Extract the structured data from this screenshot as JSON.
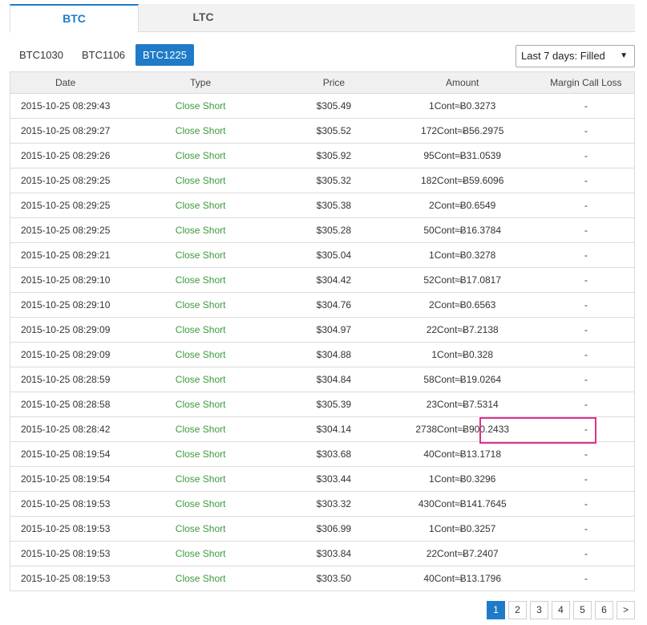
{
  "tabs": [
    {
      "label": "BTC",
      "active": true
    },
    {
      "label": "LTC",
      "active": false
    }
  ],
  "contract_tabs": [
    {
      "label": "BTC1030",
      "active": false
    },
    {
      "label": "BTC1106",
      "active": false
    },
    {
      "label": "BTC1225",
      "active": true
    }
  ],
  "filter": {
    "selected": "Last 7 days: Filled"
  },
  "colors": {
    "accent": "#1f7bc8",
    "type_text": "#3c9a3c",
    "highlight": "#e0308a"
  },
  "table": {
    "headers": [
      "Date",
      "Type",
      "Price",
      "Amount",
      "Margin Call Loss"
    ],
    "rows": [
      [
        "2015-10-25 08:29:43",
        "Close Short",
        "$305.49",
        "1Cont≈Ƀ0.3273",
        "-"
      ],
      [
        "2015-10-25 08:29:27",
        "Close Short",
        "$305.52",
        "172Cont≈Ƀ56.2975",
        "-"
      ],
      [
        "2015-10-25 08:29:26",
        "Close Short",
        "$305.92",
        "95Cont≈Ƀ31.0539",
        "-"
      ],
      [
        "2015-10-25 08:29:25",
        "Close Short",
        "$305.32",
        "182Cont≈Ƀ59.6096",
        "-"
      ],
      [
        "2015-10-25 08:29:25",
        "Close Short",
        "$305.38",
        "2Cont≈Ƀ0.6549",
        "-"
      ],
      [
        "2015-10-25 08:29:25",
        "Close Short",
        "$305.28",
        "50Cont≈Ƀ16.3784",
        "-"
      ],
      [
        "2015-10-25 08:29:21",
        "Close Short",
        "$305.04",
        "1Cont≈Ƀ0.3278",
        "-"
      ],
      [
        "2015-10-25 08:29:10",
        "Close Short",
        "$304.42",
        "52Cont≈Ƀ17.0817",
        "-"
      ],
      [
        "2015-10-25 08:29:10",
        "Close Short",
        "$304.76",
        "2Cont≈Ƀ0.6563",
        "-"
      ],
      [
        "2015-10-25 08:29:09",
        "Close Short",
        "$304.97",
        "22Cont≈Ƀ7.2138",
        "-"
      ],
      [
        "2015-10-25 08:29:09",
        "Close Short",
        "$304.88",
        "1Cont≈Ƀ0.328",
        "-"
      ],
      [
        "2015-10-25 08:28:59",
        "Close Short",
        "$304.84",
        "58Cont≈Ƀ19.0264",
        "-"
      ],
      [
        "2015-10-25 08:28:58",
        "Close Short",
        "$305.39",
        "23Cont≈Ƀ7.5314",
        "-"
      ],
      [
        "2015-10-25 08:28:42",
        "Close Short",
        "$304.14",
        "2738Cont≈Ƀ900.2433",
        "-"
      ],
      [
        "2015-10-25 08:19:54",
        "Close Short",
        "$303.68",
        "40Cont≈Ƀ13.1718",
        "-"
      ],
      [
        "2015-10-25 08:19:54",
        "Close Short",
        "$303.44",
        "1Cont≈Ƀ0.3296",
        "-"
      ],
      [
        "2015-10-25 08:19:53",
        "Close Short",
        "$303.32",
        "430Cont≈Ƀ141.7645",
        "-"
      ],
      [
        "2015-10-25 08:19:53",
        "Close Short",
        "$306.99",
        "1Cont≈Ƀ0.3257",
        "-"
      ],
      [
        "2015-10-25 08:19:53",
        "Close Short",
        "$303.84",
        "22Cont≈Ƀ7.2407",
        "-"
      ],
      [
        "2015-10-25 08:19:53",
        "Close Short",
        "$303.50",
        "40Cont≈Ƀ13.1796",
        "-"
      ]
    ]
  },
  "pagination": {
    "pages": [
      "1",
      "2",
      "3",
      "4",
      "5",
      "6"
    ],
    "current": "1",
    "next": ">"
  }
}
